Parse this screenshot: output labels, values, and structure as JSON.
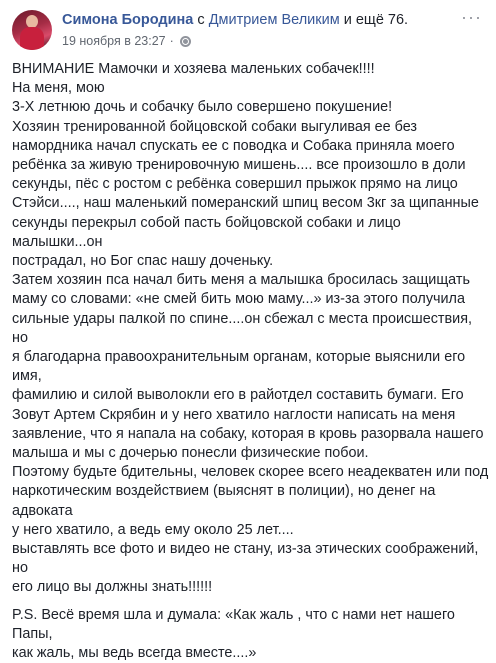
{
  "post": {
    "author": "Симона Бородина",
    "with_text": "с",
    "tagged_person": "Дмитрием Великим",
    "and_others": "и ещё 76.",
    "timestamp": "19 ноября в 23:27",
    "meta_separator": "·",
    "privacy_icon": "globe-icon",
    "more_icon": "more-dots-icon",
    "lines": [
      "ВНИМАНИЕ Мамочки и хозяева маленьких собачек!!!!",
      "На меня, мою",
      "3-Х летнюю дочь и собачку было совершено покушение!",
      "Хозяин тренированной бойцовской собаки выгуливая ее без",
      "намордника начал спускать ее с поводка и Собака приняла моего",
      "ребёнка за живую тренировочную мишень.... все произошло в доли",
      "секунды, пёс с ростом с ребёнка совершил прыжок прямо на лицо",
      "Стэйси...., наш маленький померанский шпиц весом 3кг за щипанные",
      "секунды перекрыл собой пасть бойцовской собаки и лицо малышки...он",
      "пострадал, но Бог спас нашу доченьку.",
      "Затем хозяин пса начал бить меня а малышка бросилась защищать",
      "маму со словами: «не смей бить мою маму...» из-за этого получила",
      "сильные удары палкой по спине....он сбежал с места происшествия, но",
      "я благодарна правоохранительным органам, которые выяснили его имя,",
      "фамилию и силой выволокли его в райотдел составить бумаги. Его",
      "Зовут Артем Скрябин и у него хватило наглости написать на меня",
      "заявление, что я напала на собаку, которая в кровь разорвала нашего",
      "малыша и мы с дочерью понесли физические побои.",
      "Поэтому будьте бдительны, человек скорее всего неадекватен или под",
      "наркотическим воздействием (выяснят в полиции), но денег на адвоката",
      "у него хватило, а ведь ему около 25 лет....",
      "выставлять все фото и видео не стану, из-за этических соображений, но",
      "его лицо вы должны знать!!!!!!"
    ],
    "ps_lines": [
      "P.S. Весё время шла и думала: «Как жаль , что с нами нет нашего Папы,",
      "как жаль, мы ведь всегда вместе....»"
    ]
  }
}
